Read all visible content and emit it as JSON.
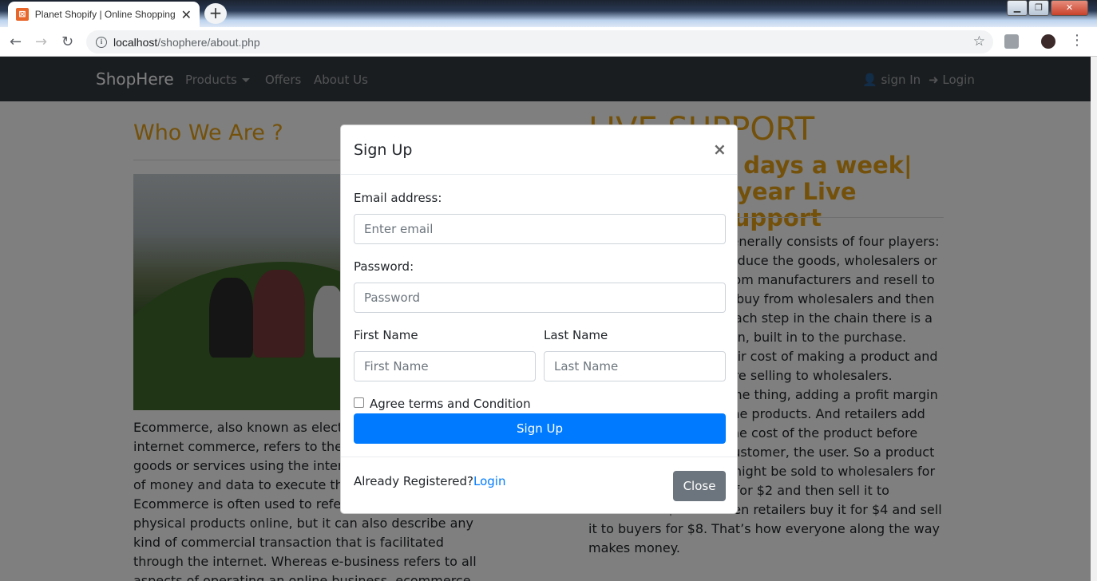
{
  "browser": {
    "tab_title": "Planet Shopify | Online Shopping",
    "tab_close": "✕",
    "new_tab": "+",
    "url_host": "localhost",
    "url_path": "/shophere/about.php",
    "window_min": "▁",
    "window_max": "❐",
    "window_close": "✕"
  },
  "navbar": {
    "brand": "ShopHere",
    "products": "Products",
    "offers": "Offers",
    "about": "About Us",
    "signin": "sign In",
    "login": "Login"
  },
  "about": {
    "heading": "Who We Are ?",
    "text": "Ecommerce, also known as electronic commerce or internet commerce, refers to the buying and selling of goods or services using the internet, and the transfer of money and data to execute these transactions. Ecommerce is often used to refer to the sale of physical products online, but it can also describe any kind of commercial transaction that is facilitated through the internet. Whereas e-business refers to all aspects of operating an online business, ecommerce refers specifically to the transaction of goods and services."
  },
  "support": {
    "heading": "LIVE SUPPORT",
    "subheading": "24 hours| 7 days a week| 365 days a year Live Technical Support",
    "text": "A retail supply chain generally consists of four players: manufacturers who produce the goods, wholesalers or distributors who buy from manufacturers and resell to retailers, retailers who buy from wholesalers and then sell to consumers. At each step in the chain there is a markup, or profit margin, built in to the purchase. Manufacturers take their cost of making a product and add a percentage before selling to wholesalers. Wholesalers do the same thing, adding a profit margin to what they paid for the products. And retailers add their profit margin to the cost of the product before selling it to their end customer, the user. So a product that cost $1 to make, might be sold to wholesalers for $2. Wholesalers buy it for $2 and then sell it to retailers for $4. And then retailers buy it for $4 and sell it to buyers for $8. That’s how everyone along the way makes money."
  },
  "modal": {
    "title": "Sign Up",
    "close_x": "×",
    "email_label": "Email address:",
    "email_placeholder": "Enter email",
    "password_label": "Password:",
    "password_placeholder": "Password",
    "first_name_label": "First Name",
    "first_name_placeholder": "First Name",
    "last_name_label": "Last Name",
    "last_name_placeholder": "Last Name",
    "agree_label": "Agree terms and Condition",
    "signup_button": "Sign Up",
    "already_registered": "Already Registered?",
    "login_link": "Login",
    "close_button": "Close"
  },
  "colors": {
    "accent": "#e8a317",
    "primary": "#007bff",
    "navbar": "#343a40",
    "secondary": "#6c757d"
  }
}
